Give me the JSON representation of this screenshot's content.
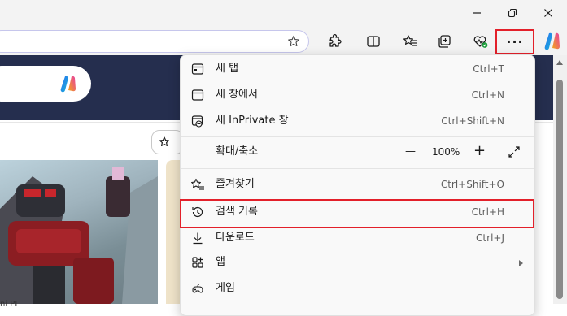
{
  "window": {
    "minimize_icon": "minimize-icon",
    "restore_icon": "restore-icon",
    "close_icon": "close-icon"
  },
  "toolbar": {
    "favorite_icon": "star-outline-icon",
    "extensions_icon": "puzzle-icon",
    "split_screen_icon": "split-screen-icon",
    "favorites_icon": "favorites-list-icon",
    "collections_icon": "collections-icon",
    "browser_essentials_icon": "heart-pulse-icon",
    "more_label": "···",
    "copilot_icon": "copilot-icon"
  },
  "page": {
    "card_caption": "ni PI"
  },
  "menu": {
    "items": [
      {
        "label": "새 탭",
        "shortcut": "Ctrl+T",
        "icon": "new-tab-icon"
      },
      {
        "label": "새 창에서",
        "shortcut": "Ctrl+N",
        "icon": "new-window-icon"
      },
      {
        "label": "새 InPrivate 창",
        "shortcut": "Ctrl+Shift+N",
        "icon": "inprivate-icon"
      },
      {
        "label": "확대/축소",
        "zoom_minus": "—",
        "zoom_value": "100%",
        "zoom_plus": "+",
        "icon": "fullscreen-icon"
      },
      {
        "label": "즐겨찾기",
        "shortcut": "Ctrl+Shift+O",
        "icon": "favorites-star-icon"
      },
      {
        "label": "검색 기록",
        "shortcut": "Ctrl+H",
        "icon": "history-icon"
      },
      {
        "label": "다운로드",
        "shortcut": "Ctrl+J",
        "icon": "download-icon"
      },
      {
        "label": "앱",
        "shortcut": "",
        "icon": "apps-icon"
      },
      {
        "label": "게임",
        "shortcut": "",
        "icon": "games-icon"
      }
    ]
  },
  "colors": {
    "highlight": "#e3202a",
    "banner": "#252e4e",
    "address_border": "#c6c6ec"
  }
}
